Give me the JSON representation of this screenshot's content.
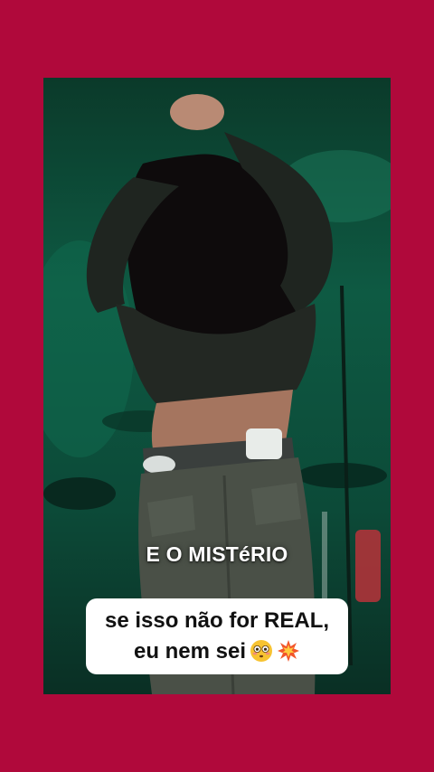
{
  "video": {
    "scene": "dancer-on-stage"
  },
  "overlay": {
    "title_text": "E O MISTéRIO",
    "caption_line1": "se isso não for REAL,",
    "caption_line2": "eu nem sei",
    "emoji1": "flushed-face-emoji",
    "emoji2": "collision-emoji"
  },
  "colors": {
    "background": "#b0093b",
    "stage_green": "#0e5a43",
    "caption_bg": "#ffffff",
    "caption_text": "#111111",
    "title_text": "#ffffff"
  }
}
